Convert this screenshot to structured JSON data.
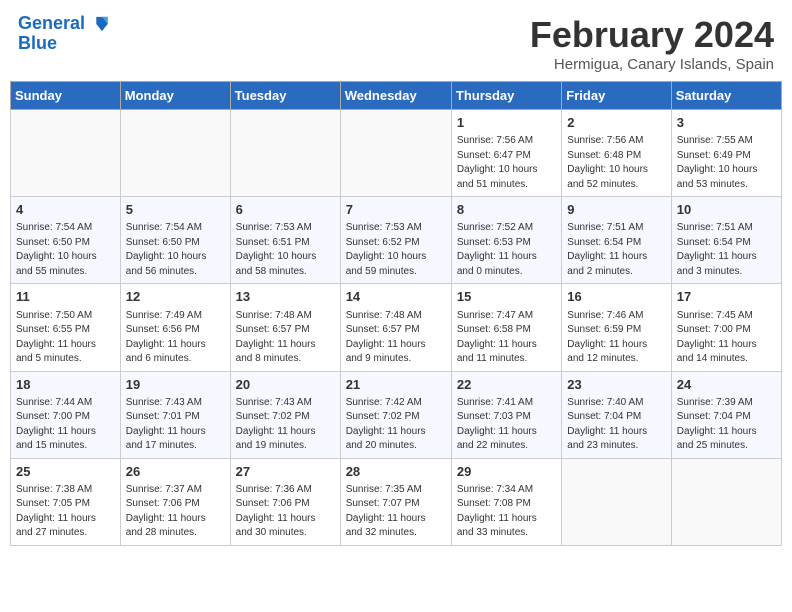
{
  "header": {
    "logo_line1": "General",
    "logo_line2": "Blue",
    "title": "February 2024",
    "location": "Hermigua, Canary Islands, Spain"
  },
  "weekdays": [
    "Sunday",
    "Monday",
    "Tuesday",
    "Wednesday",
    "Thursday",
    "Friday",
    "Saturday"
  ],
  "weeks": [
    [
      {
        "day": "",
        "info": ""
      },
      {
        "day": "",
        "info": ""
      },
      {
        "day": "",
        "info": ""
      },
      {
        "day": "",
        "info": ""
      },
      {
        "day": "1",
        "info": "Sunrise: 7:56 AM\nSunset: 6:47 PM\nDaylight: 10 hours\nand 51 minutes."
      },
      {
        "day": "2",
        "info": "Sunrise: 7:56 AM\nSunset: 6:48 PM\nDaylight: 10 hours\nand 52 minutes."
      },
      {
        "day": "3",
        "info": "Sunrise: 7:55 AM\nSunset: 6:49 PM\nDaylight: 10 hours\nand 53 minutes."
      }
    ],
    [
      {
        "day": "4",
        "info": "Sunrise: 7:54 AM\nSunset: 6:50 PM\nDaylight: 10 hours\nand 55 minutes."
      },
      {
        "day": "5",
        "info": "Sunrise: 7:54 AM\nSunset: 6:50 PM\nDaylight: 10 hours\nand 56 minutes."
      },
      {
        "day": "6",
        "info": "Sunrise: 7:53 AM\nSunset: 6:51 PM\nDaylight: 10 hours\nand 58 minutes."
      },
      {
        "day": "7",
        "info": "Sunrise: 7:53 AM\nSunset: 6:52 PM\nDaylight: 10 hours\nand 59 minutes."
      },
      {
        "day": "8",
        "info": "Sunrise: 7:52 AM\nSunset: 6:53 PM\nDaylight: 11 hours\nand 0 minutes."
      },
      {
        "day": "9",
        "info": "Sunrise: 7:51 AM\nSunset: 6:54 PM\nDaylight: 11 hours\nand 2 minutes."
      },
      {
        "day": "10",
        "info": "Sunrise: 7:51 AM\nSunset: 6:54 PM\nDaylight: 11 hours\nand 3 minutes."
      }
    ],
    [
      {
        "day": "11",
        "info": "Sunrise: 7:50 AM\nSunset: 6:55 PM\nDaylight: 11 hours\nand 5 minutes."
      },
      {
        "day": "12",
        "info": "Sunrise: 7:49 AM\nSunset: 6:56 PM\nDaylight: 11 hours\nand 6 minutes."
      },
      {
        "day": "13",
        "info": "Sunrise: 7:48 AM\nSunset: 6:57 PM\nDaylight: 11 hours\nand 8 minutes."
      },
      {
        "day": "14",
        "info": "Sunrise: 7:48 AM\nSunset: 6:57 PM\nDaylight: 11 hours\nand 9 minutes."
      },
      {
        "day": "15",
        "info": "Sunrise: 7:47 AM\nSunset: 6:58 PM\nDaylight: 11 hours\nand 11 minutes."
      },
      {
        "day": "16",
        "info": "Sunrise: 7:46 AM\nSunset: 6:59 PM\nDaylight: 11 hours\nand 12 minutes."
      },
      {
        "day": "17",
        "info": "Sunrise: 7:45 AM\nSunset: 7:00 PM\nDaylight: 11 hours\nand 14 minutes."
      }
    ],
    [
      {
        "day": "18",
        "info": "Sunrise: 7:44 AM\nSunset: 7:00 PM\nDaylight: 11 hours\nand 15 minutes."
      },
      {
        "day": "19",
        "info": "Sunrise: 7:43 AM\nSunset: 7:01 PM\nDaylight: 11 hours\nand 17 minutes."
      },
      {
        "day": "20",
        "info": "Sunrise: 7:43 AM\nSunset: 7:02 PM\nDaylight: 11 hours\nand 19 minutes."
      },
      {
        "day": "21",
        "info": "Sunrise: 7:42 AM\nSunset: 7:02 PM\nDaylight: 11 hours\nand 20 minutes."
      },
      {
        "day": "22",
        "info": "Sunrise: 7:41 AM\nSunset: 7:03 PM\nDaylight: 11 hours\nand 22 minutes."
      },
      {
        "day": "23",
        "info": "Sunrise: 7:40 AM\nSunset: 7:04 PM\nDaylight: 11 hours\nand 23 minutes."
      },
      {
        "day": "24",
        "info": "Sunrise: 7:39 AM\nSunset: 7:04 PM\nDaylight: 11 hours\nand 25 minutes."
      }
    ],
    [
      {
        "day": "25",
        "info": "Sunrise: 7:38 AM\nSunset: 7:05 PM\nDaylight: 11 hours\nand 27 minutes."
      },
      {
        "day": "26",
        "info": "Sunrise: 7:37 AM\nSunset: 7:06 PM\nDaylight: 11 hours\nand 28 minutes."
      },
      {
        "day": "27",
        "info": "Sunrise: 7:36 AM\nSunset: 7:06 PM\nDaylight: 11 hours\nand 30 minutes."
      },
      {
        "day": "28",
        "info": "Sunrise: 7:35 AM\nSunset: 7:07 PM\nDaylight: 11 hours\nand 32 minutes."
      },
      {
        "day": "29",
        "info": "Sunrise: 7:34 AM\nSunset: 7:08 PM\nDaylight: 11 hours\nand 33 minutes."
      },
      {
        "day": "",
        "info": ""
      },
      {
        "day": "",
        "info": ""
      }
    ]
  ]
}
